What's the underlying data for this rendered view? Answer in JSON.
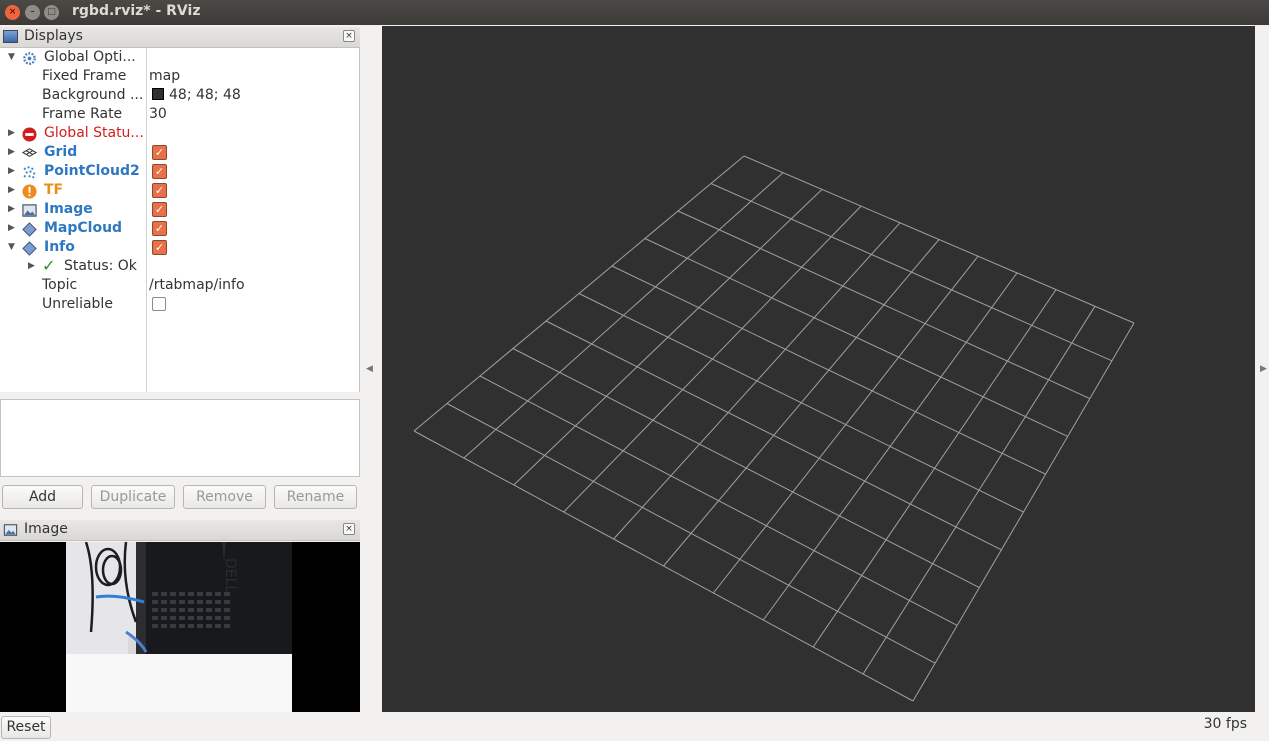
{
  "window": {
    "title": "rgbd.rviz* - RViz"
  },
  "displays_panel": {
    "title": "Displays",
    "rows": [
      {
        "label": "Global Opti...",
        "value": ""
      },
      {
        "label": "Fixed Frame",
        "value": "map"
      },
      {
        "label": "Background ...",
        "value": "48; 48; 48"
      },
      {
        "label": "Frame Rate",
        "value": "30"
      },
      {
        "label": "Global Statu...",
        "value": ""
      },
      {
        "label": "Grid",
        "checked": true
      },
      {
        "label": "PointCloud2",
        "checked": true
      },
      {
        "label": "TF",
        "checked": true
      },
      {
        "label": "Image",
        "checked": true
      },
      {
        "label": "MapCloud",
        "checked": true
      },
      {
        "label": "Info",
        "checked": true
      },
      {
        "label": "Status: Ok",
        "value": ""
      },
      {
        "label": "Topic",
        "value": "/rtabmap/info"
      },
      {
        "label": "Unreliable",
        "checked": false
      }
    ],
    "buttons": {
      "add": "Add",
      "duplicate": "Duplicate",
      "remove": "Remove",
      "rename": "Rename"
    }
  },
  "image_panel": {
    "title": "Image"
  },
  "status_bar": {
    "reset": "Reset",
    "fps": "30 fps"
  },
  "colors": {
    "background": "#303030",
    "grid": "#a0a0a0",
    "checkbox": "#e9714a"
  }
}
